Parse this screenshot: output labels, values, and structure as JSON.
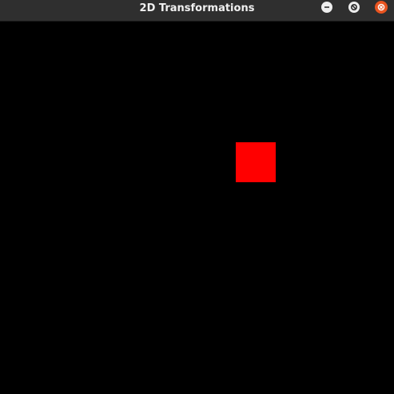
{
  "window": {
    "title": "2D Transformations"
  },
  "titlebar_buttons": {
    "minimize_icon": "minimize-icon",
    "maximize_icon": "maximize-icon",
    "close_icon": "close-icon"
  },
  "colors": {
    "titlebar": "#2f2f2f",
    "canvas_background": "#000000",
    "square_fill": "#ff0000",
    "close_button": "#e95420"
  }
}
